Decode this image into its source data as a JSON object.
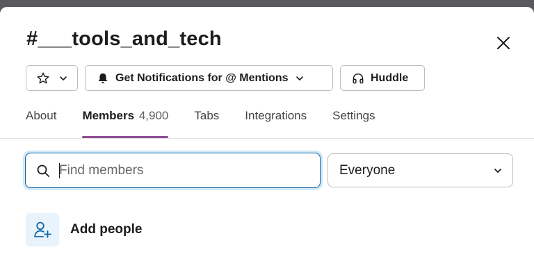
{
  "channel": {
    "title": "#___tools_and_tech"
  },
  "buttons": {
    "notifications_label": "Get Notifications for @ Mentions",
    "huddle_label": "Huddle"
  },
  "tabs": [
    {
      "label": "About"
    },
    {
      "label": "Members",
      "count": "4,900",
      "active": true
    },
    {
      "label": "Tabs"
    },
    {
      "label": "Integrations"
    },
    {
      "label": "Settings"
    }
  ],
  "search": {
    "placeholder": "Find members",
    "value": ""
  },
  "filter": {
    "selected": "Everyone"
  },
  "add_people": {
    "label": "Add people"
  },
  "icons": {
    "close": "close-icon",
    "star": "star-icon",
    "bell": "bell-icon",
    "headphones": "headphones-icon",
    "search": "search-icon",
    "chevron": "chevron-down-icon",
    "add_user": "add-user-icon"
  },
  "colors": {
    "active_tab_underline": "#8f4f96",
    "search_focus_border": "#1264a3",
    "search_focus_ring": "#cfe8f7",
    "add_icon_bg": "#e8f3fb",
    "add_icon": "#1264a3"
  }
}
